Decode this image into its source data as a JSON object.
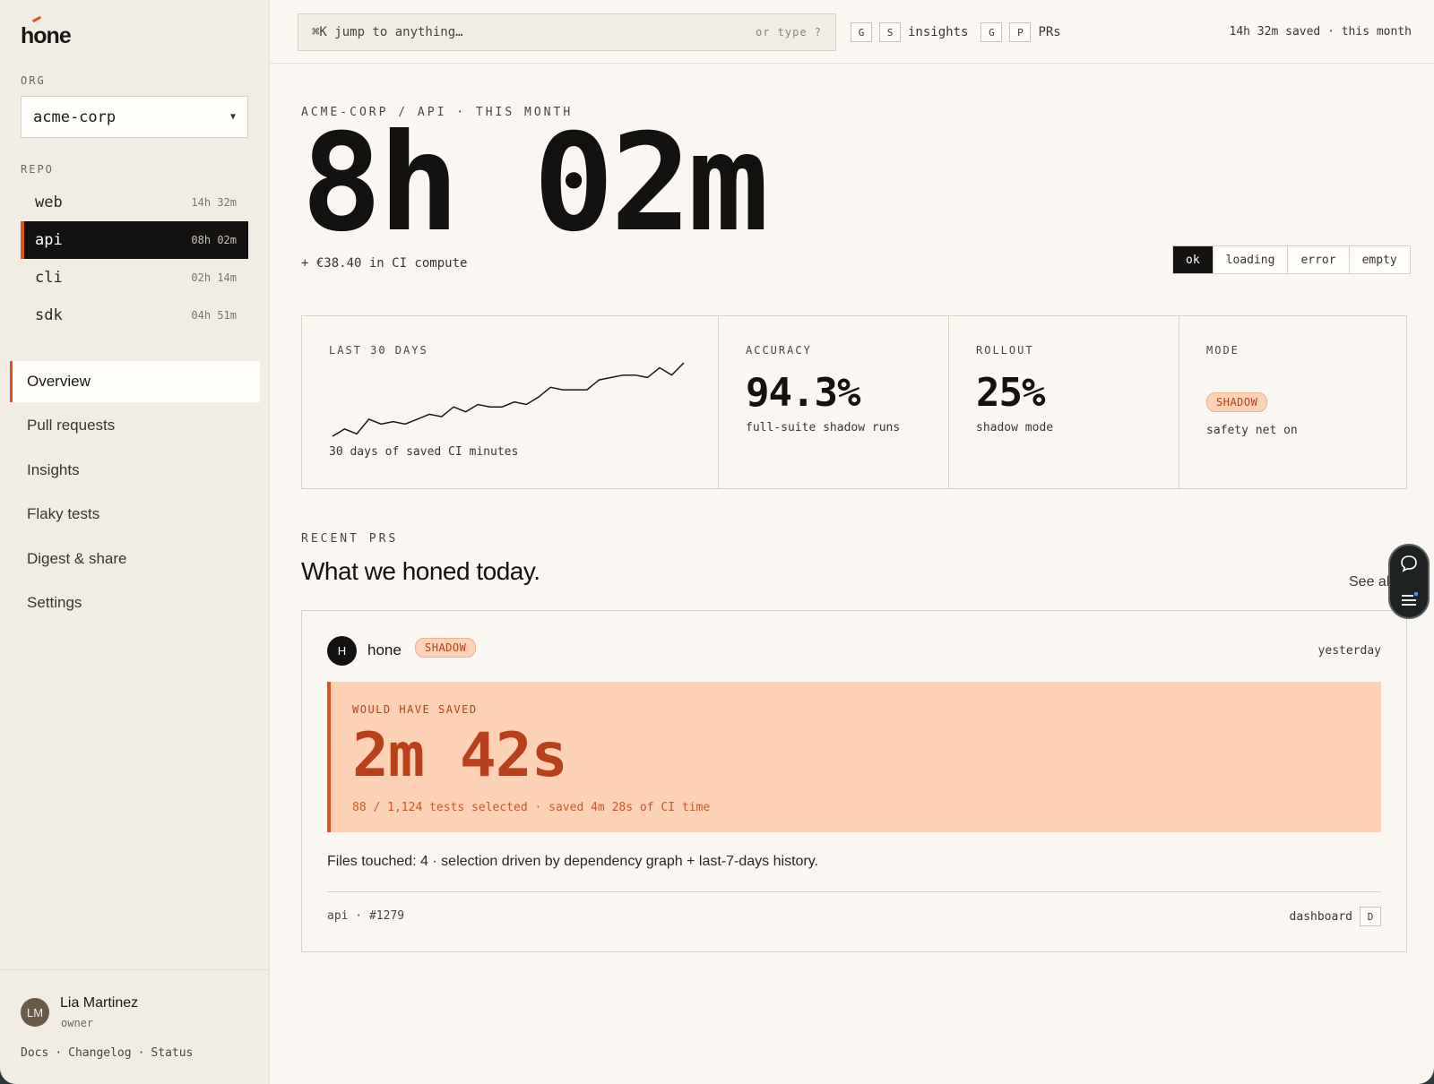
{
  "app": {
    "logo": "hone"
  },
  "sidebar": {
    "org_label": "ORG",
    "org_value": "acme-corp",
    "repo_label": "REPO",
    "repos": [
      {
        "name": "web",
        "time": "14h 32m",
        "active": false
      },
      {
        "name": "api",
        "time": "08h 02m",
        "active": true
      },
      {
        "name": "cli",
        "time": "02h 14m",
        "active": false
      },
      {
        "name": "sdk",
        "time": "04h 51m",
        "active": false
      }
    ],
    "nav": [
      {
        "label": "Overview",
        "active": true
      },
      {
        "label": "Pull requests",
        "active": false
      },
      {
        "label": "Insights",
        "active": false
      },
      {
        "label": "Flaky tests",
        "active": false
      },
      {
        "label": "Digest & share",
        "active": false
      },
      {
        "label": "Settings",
        "active": false
      }
    ],
    "user": {
      "initials": "LM",
      "name": "Lia Martinez",
      "role": "owner"
    },
    "footer_links": [
      "Docs",
      "·",
      "Changelog",
      "·",
      "Status"
    ]
  },
  "topbar": {
    "search_placeholder": "⌘K  jump to anything…",
    "search_hint": "or type ?",
    "shortcuts": [
      {
        "keys": [
          "G",
          "S"
        ],
        "label": "insights"
      },
      {
        "keys": [
          "G",
          "P"
        ],
        "label": "PRs"
      }
    ],
    "saved_summary": "14h 32m saved · this month"
  },
  "hero": {
    "breadcrumb": "ACME-CORP / API · THIS MONTH",
    "value": "8h 02m",
    "subtitle": "+ €38.40 in CI compute",
    "states": [
      {
        "label": "ok",
        "active": true
      },
      {
        "label": "loading",
        "active": false
      },
      {
        "label": "error",
        "active": false
      },
      {
        "label": "empty",
        "active": false
      }
    ]
  },
  "stats": {
    "trend": {
      "label": "LAST 30 DAYS",
      "note": "30 days of saved CI minutes",
      "values": [
        4,
        7,
        5,
        11,
        9,
        10,
        9,
        11,
        13,
        12,
        16,
        14,
        17,
        16,
        16,
        18,
        17,
        20,
        24,
        23,
        23,
        23,
        27,
        28,
        29,
        29,
        28,
        32,
        29,
        34
      ]
    },
    "accuracy": {
      "label": "ACCURACY",
      "value": "94.3%",
      "note": "full-suite shadow runs"
    },
    "rollout": {
      "label": "ROLLOUT",
      "value": "25%",
      "note": "shadow mode"
    },
    "mode": {
      "label": "MODE",
      "badge": "SHADOW",
      "note": "safety net on"
    }
  },
  "recent": {
    "label": "RECENT PRS",
    "title": "What we honed today.",
    "see_all": "See all",
    "pr": {
      "avatar": "H",
      "author": "hone",
      "badge": "SHADOW",
      "time": "yesterday",
      "saved_label": "WOULD HAVE SAVED",
      "saved_value": "2m 42s",
      "saved_detail": "88 / 1,124 tests selected · saved 4m 28s of CI time",
      "description": "Files touched: 4 · selection driven by dependency graph + last-7-days history.",
      "ref": "api · #1279",
      "action_label": "dashboard",
      "action_key": "D"
    }
  },
  "colors": {
    "accent": "#d9541e",
    "ink": "#141210",
    "paper": "#faf7f2",
    "sidebar": "#f1ede5",
    "highlight": "#fdd2b4"
  }
}
